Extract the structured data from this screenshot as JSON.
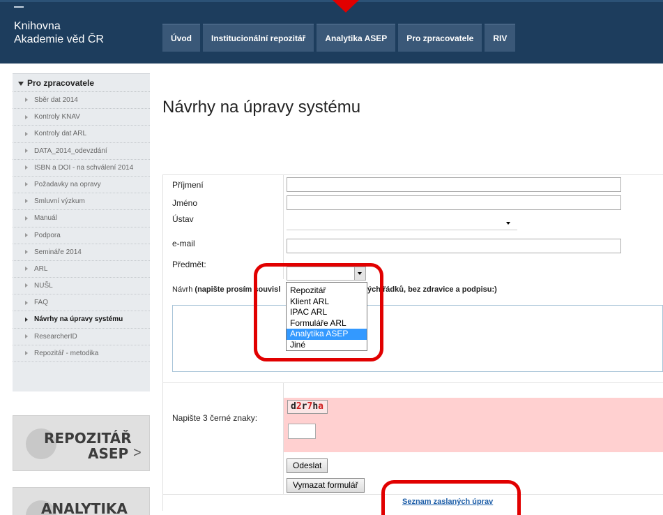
{
  "header": {
    "title_line1": "Knihovna",
    "title_line2": "Akademie věd ČR",
    "nav": [
      "Úvod",
      "Institucionální repozitář",
      "Analytika ASEP",
      "Pro zpracovatele",
      "RIV"
    ]
  },
  "sidebar": {
    "heading": "Pro zpracovatele",
    "items": [
      "Sběr dat 2014",
      "Kontroly KNAV",
      "Kontroly dat ARL",
      "DATA_2014_odevzdání",
      "ISBN a DOI - na schválení 2014",
      "Požadavky na opravy",
      "Smluvní výzkum",
      "Manuál",
      "Podpora",
      "Semináře 2014",
      "ARL",
      "NUŠL",
      "FAQ",
      "Návrhy na úpravy systému",
      "ResearcherID",
      "Repozitář - metodika"
    ],
    "active_index": 13
  },
  "promo": {
    "repo_line1": "REPOZITÁŘ",
    "repo_line2": "ASEP",
    "repo_chevron": ">",
    "analytika": "ANALYTIKA"
  },
  "main": {
    "title": "Návrhy na úpravy systému",
    "fields": {
      "prijmeni": "Příjmení",
      "jmeno": "Jméno",
      "ustav": "Ústav",
      "email": "e-mail",
      "predmet": "Předmět:"
    },
    "navrh_prefix": "Návrh",
    "navrh_bold_left": "(napište prosím souvisl",
    "navrh_bold_right": "ých řádků, bez zdravice a podpisu:)",
    "dropdown_options": [
      "Repozitář",
      "Klient ARL",
      "IPAC ARL",
      "Formuláře ARL",
      "Analytika ASEP",
      "Jiné"
    ],
    "dropdown_selected_index": 4,
    "captcha_label": "Napište 3 černé znaky:",
    "captcha_chars": [
      {
        "c": "d",
        "color": "black"
      },
      {
        "c": "2",
        "color": "red"
      },
      {
        "c": "r",
        "color": "black"
      },
      {
        "c": "7",
        "color": "red"
      },
      {
        "c": "h",
        "color": "black"
      },
      {
        "c": "a",
        "color": "red"
      }
    ],
    "submit_label": "Odeslat",
    "clear_label": "Vymazat formulář",
    "list_link": "Seznam zaslaných úprav"
  },
  "colors": {
    "header_bg": "#1d3d5d",
    "nav_bg": "#3a5878",
    "highlight": "#e10000",
    "link": "#1d5ea8",
    "captcha_bg": "#ffd0d0",
    "dropdown_selected": "#3399ff"
  }
}
